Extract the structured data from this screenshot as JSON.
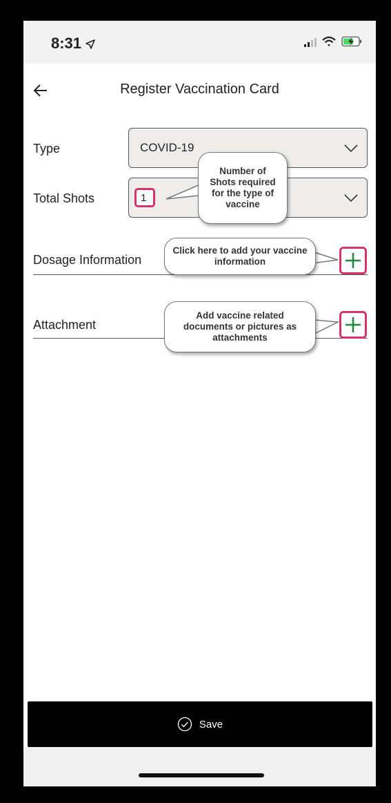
{
  "status_bar": {
    "time": "8:31"
  },
  "header": {
    "title": "Register Vaccination Card"
  },
  "form": {
    "type_label": "Type",
    "type_value": "COVID-19",
    "total_shots_label": "Total Shots",
    "total_shots_value": "1",
    "dosage_label": "Dosage Information",
    "attachment_label": "Attachment"
  },
  "callouts": {
    "shots": "Number of Shots required for the type of vaccine",
    "dosage": "Click here to add your vaccine information",
    "attachment": "Add vaccine related documents or pictures as attachments"
  },
  "footer": {
    "save_label": "Save"
  },
  "colors": {
    "highlight": "#d6336c",
    "plus": "#1f8a3a",
    "save_bg": "#000000"
  },
  "icons": [
    "location-arrow-icon",
    "signal-icon",
    "wifi-icon",
    "battery-charging-icon",
    "back-arrow-icon",
    "chevron-down-icon",
    "plus-icon",
    "check-circle-icon"
  ]
}
